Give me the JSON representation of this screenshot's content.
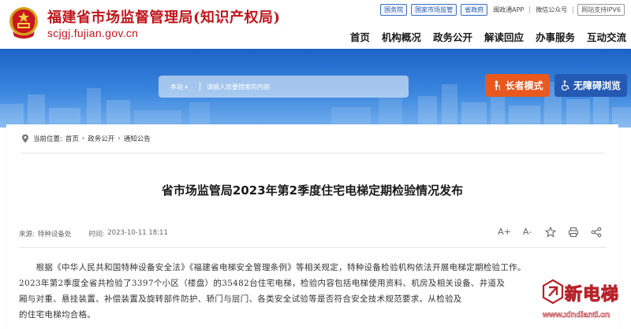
{
  "header": {
    "site_title": "福建省市场监督管理局(知识产权局)",
    "site_domain": "scjgj.fujian.gov.cn",
    "top_links": [
      "国务院",
      "国家市场监管",
      "省政府"
    ],
    "app_link": "闽政通APP",
    "wechat_link": "微信公众号",
    "ipv6_badge": "网站支持IPV6",
    "nav": [
      "首页",
      "机构概况",
      "政务公开",
      "解读回应",
      "办事服务",
      "互动交流"
    ]
  },
  "search": {
    "scope": "本站",
    "placeholder": "请输入您要搜索的内容"
  },
  "accessibility": {
    "elder_mode": "长者模式",
    "barrier_free": "无障碍浏览"
  },
  "breadcrumb": {
    "prefix": "当前位置:",
    "items": [
      "首页",
      "政务公开",
      "通知公告"
    ],
    "separator": "›"
  },
  "article": {
    "title": "省市场监管局2023年第2季度住宅电梯定期检验情况发布",
    "source_label": "来源:",
    "source_value": "特种设备处",
    "time_label": "时间:",
    "time_value": "2023-10-11 18:11",
    "paragraph_lines": [
      "　　根据《中华人民共和国特种设备安全法》《福建省电梯安全管理条例》等相关规定，特种设备检验机构依法开展电梯定期检验工作。",
      "2023年第2季度全省共检验了3397个小区（楼盘）的35482台住宅电梯，检验内容包括电梯使用资料、机房及相关设备、井道及",
      "厢与对重、悬挂装置、补偿装置及旋转部件防护、轿门与层门、各类安全试验等是否符合安全技术规范要求。从检验及",
      "的住宅电梯均合格。"
    ]
  },
  "tools": {
    "font_larger": "A+",
    "font_smaller": "A-"
  },
  "watermark": {
    "name": "新电梯",
    "url": "www.xindianti.cn"
  },
  "colors": {
    "brand_red": "#c0161b",
    "banner_blue": "#1d63c7",
    "elder_orange": "#e8581f",
    "access_blue": "#2459b4"
  }
}
